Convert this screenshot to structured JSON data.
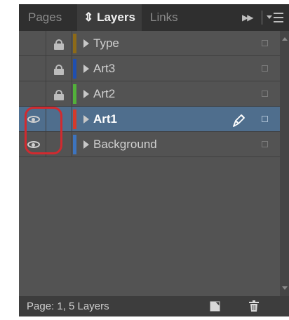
{
  "tabs": [
    {
      "label": "Pages"
    },
    {
      "label": "Layers",
      "prefix": "⇕",
      "active": true
    },
    {
      "label": "Links"
    }
  ],
  "tab_icons": {
    "forward": "fast-forward-icon",
    "menu": "panel-menu-icon",
    "forward_glyph": "▶▶"
  },
  "layers": [
    {
      "name": "Type",
      "color": "#8d6a17",
      "locked": true,
      "visible": false,
      "selected": false
    },
    {
      "name": "Art3",
      "color": "#1f4fb0",
      "locked": true,
      "visible": false,
      "selected": false
    },
    {
      "name": "Art2",
      "color": "#52b13a",
      "locked": true,
      "visible": false,
      "selected": false
    },
    {
      "name": "Art1",
      "color": "#d43a2b",
      "locked": false,
      "visible": true,
      "selected": true
    },
    {
      "name": "Background",
      "color": "#3d74bf",
      "locked": false,
      "visible": true,
      "selected": false
    }
  ],
  "footer": {
    "status": "Page: 1, 5 Layers"
  },
  "icons": {
    "eye": "eye-icon",
    "lock": "lock-icon",
    "pen": "pen-icon",
    "new_layer": "new-layer-icon",
    "trash": "trash-icon"
  }
}
